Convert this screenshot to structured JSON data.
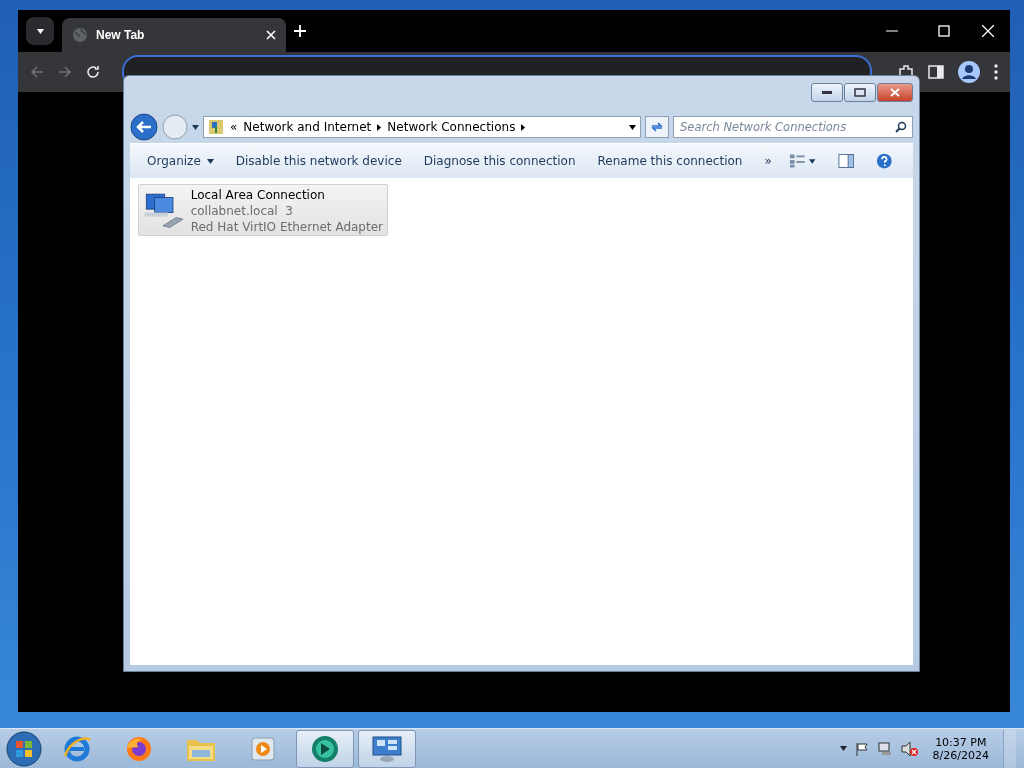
{
  "browser": {
    "tabs": [
      {
        "title": "New Tab",
        "selected": true
      }
    ]
  },
  "explorer": {
    "breadcrumb": {
      "overflow": "«",
      "parts": [
        "Network and Internet",
        "Network Connections"
      ]
    },
    "search": {
      "placeholder": "Search Network Connections"
    },
    "commands": [
      {
        "label": "Organize",
        "kind": "menu"
      },
      {
        "label": "Disable this network device",
        "kind": "plain"
      },
      {
        "label": "Diagnose this connection",
        "kind": "plain"
      },
      {
        "label": "Rename this connection",
        "kind": "plain"
      }
    ],
    "more": "»",
    "items": [
      {
        "name": "Local Area Connection",
        "lines": [
          "collabnet.local  3",
          "Red Hat VirtIO Ethernet Adapter"
        ],
        "selected": true
      }
    ]
  },
  "taskbar": {
    "pins": [
      {
        "kind": "browser-e",
        "running": false
      },
      {
        "kind": "browser-fox",
        "running": false
      },
      {
        "kind": "folder",
        "running": false
      },
      {
        "kind": "media",
        "running": false
      },
      {
        "kind": "disc",
        "running": true
      },
      {
        "kind": "control",
        "running": true
      }
    ],
    "clock": {
      "time": "10:37 PM",
      "date": "8/26/2024"
    }
  }
}
